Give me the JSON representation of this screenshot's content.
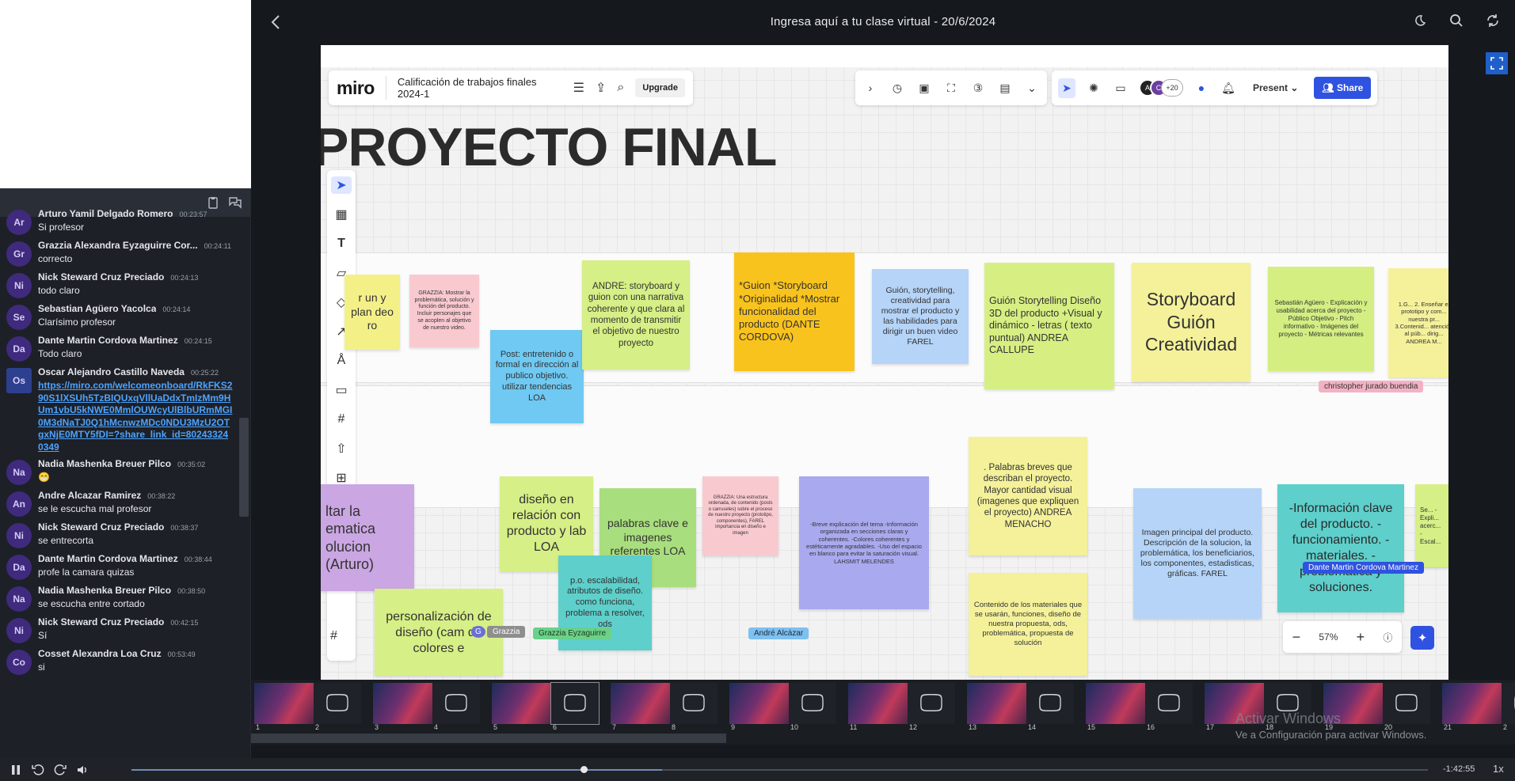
{
  "topbar": {
    "title": "Ingresa aquí a tu clase virtual - 20/6/2024"
  },
  "chat": {
    "messages": [
      {
        "initials": "Ar",
        "name": "Arturo Yamil Delgado Romero",
        "time": "00:23:57",
        "text": "Si profesor"
      },
      {
        "initials": "Gr",
        "name": "Grazzia Alexandra Eyzaguirre Cor...",
        "time": "00:24:11",
        "text": "correcto"
      },
      {
        "initials": "Ni",
        "name": "Nick Steward Cruz Preciado",
        "time": "00:24:13",
        "text": "todo claro"
      },
      {
        "initials": "Se",
        "name": "Sebastian Agüero Yacolca",
        "time": "00:24:14",
        "text": "Clarísimo profesor"
      },
      {
        "initials": "Da",
        "name": "Dante Martin Cordova Martinez",
        "time": "00:24:15",
        "text": "Todo claro"
      },
      {
        "initials": "Os",
        "name": "Oscar Alejandro Castillo Naveda",
        "time": "00:25:22",
        "text": "https://miro.com/welcomeonboard/RkFKS290S1lXSUh5TzBIQUxqVllUaDdxTmIzMm9HUm1vbU5kNWE0MmlOUWcyUlBlbURmMGI0M3dNaTJ0Q1hMcnwzMDc0NDU3MzU2OTgxNjE0MTY5fDI=?share_link_id=802433240349",
        "link": true
      },
      {
        "initials": "Na",
        "name": "Nadia Mashenka Breuer Pilco",
        "time": "00:35:02",
        "text": "😁"
      },
      {
        "initials": "An",
        "name": "Andre Alcazar Ramirez",
        "time": "00:38:22",
        "text": "se le escucha mal profesor"
      },
      {
        "initials": "Ni",
        "name": "Nick Steward Cruz Preciado",
        "time": "00:38:37",
        "text": "se entrecorta"
      },
      {
        "initials": "Da",
        "name": "Dante Martin Cordova Martinez",
        "time": "00:38:44",
        "text": "profe la camara quizas"
      },
      {
        "initials": "Na",
        "name": "Nadia Mashenka Breuer Pilco",
        "time": "00:38:50",
        "text": "se escucha entre cortado"
      },
      {
        "initials": "Ni",
        "name": "Nick Steward Cruz Preciado",
        "time": "00:42:15",
        "text": "Sí"
      },
      {
        "initials": "Co",
        "name": "Cosset Alexandra Loa Cruz",
        "time": "00:53:49",
        "text": "si"
      }
    ]
  },
  "miro": {
    "logo": "miro",
    "board_name": "Calificación de trabajos finales 2024-1",
    "upgrade": "Upgrade",
    "avatars_more": "+20",
    "present": "Present",
    "share": "Share",
    "heading": "PROYECTO FINAL",
    "zoom": "57%",
    "notes": {
      "n1": "r un y plan deo ro",
      "n2": "GRAZZIA: Mostrar la problemática, solución y función del producto. Incluir personajes que se acoplen al objetivo de nuestro video.",
      "n3": "Post: entretenido o formal en dirección al publico objetivo. utilizar tendencias LOA",
      "n4": "ANDRE: storyboard y guion con una narrativa coherente y que clara al momento de transmitir el objetivo de nuestro proyecto",
      "n5": "*Guion *Storyboard *Originalidad *Mostrar funcionalidad del producto (DANTE CORDOVA)",
      "n6": "Guión, storytelling, creatividad para mostrar el producto y las habilidades para dirigir un buen video FAREL",
      "n7": "Guión Storytelling Diseño 3D del producto +Visual y dinámico - letras ( texto puntual) ANDREA CALLUPE",
      "n8": "Storyboard Guión Creatividad",
      "n9": "Sebastián Agüero - Explicación y usabilidad acerca del proyecto - Público Objetivo - Pitch informativo - Imágenes del proyecto - Métricas relevantes",
      "n10": "1.G... 2. Enseñar el prototipo y com... nuestra pr... 3.Contenid... atención al púb... dirig... ANDREA M...",
      "n11": "ltar la ematica olucion (Arturo)",
      "n12": "diseño en relación con producto y lab LOA",
      "n13": "palabras clave e imagenes referentes LOA",
      "n14": "GRAZZIA: Una estructura ordenada, de contenido (posts o carruseles) sobre el proceso de nuestro proyecto (prototipo, componentes), FAREL importancia en diseño e imagen",
      "n15": "-Breve explicación del tema -Información organizada en secciones claras y coherentes. -Colores coherentes y estéticamente agradables. -Uso del espacio en blanco para evitar la saturación visual. LAHSMIT MELENDES",
      "n16": ". Palabras breves que describan el proyecto. Mayor cantidad visual (imagenes que expliquen el proyecto) ANDREA MENACHO",
      "n17": "Imagen principal del producto. Descripción de la solucion, la problemática, los beneficiarios, los componentes, estadisticas, gráficas. FAREL",
      "n18": "-Información clave del producto. -funcionamiento. -materiales. -problemática y soluciones.",
      "n19": "Se... - Expli... acerc... - Escal...",
      "n20": "p.o. escalabilidad, atributos de diseño. como funciona, problema a resolver, ods",
      "n21": "personalización de diseño (cam de colores e",
      "n22": "Contenido de los materiales que se usarán, funciones, diseño de nuestra propuesta, ods, problemática, propuesta de solución"
    },
    "tags": {
      "christopher": "christopher jurado buendia",
      "dante": "Dante Martin Cordova Martinez",
      "grazzia_g": "G",
      "grazzia": "Grazzia",
      "grazzia_ey": "Grazzia Eyzaguirre",
      "andre": "André Alcázar"
    }
  },
  "thumbnails": [
    "1",
    "2",
    "3",
    "4",
    "5",
    "6",
    "7",
    "8",
    "9",
    "10",
    "11",
    "12",
    "13",
    "14",
    "15",
    "16",
    "17",
    "18",
    "19",
    "20",
    "21",
    "2"
  ],
  "watermark": {
    "line1": "Activar Windows",
    "line2": "Ve a Configuración para activar Windows."
  },
  "player": {
    "time_remaining": "-1:42:55",
    "speed": "1x",
    "progress": 0.349
  }
}
